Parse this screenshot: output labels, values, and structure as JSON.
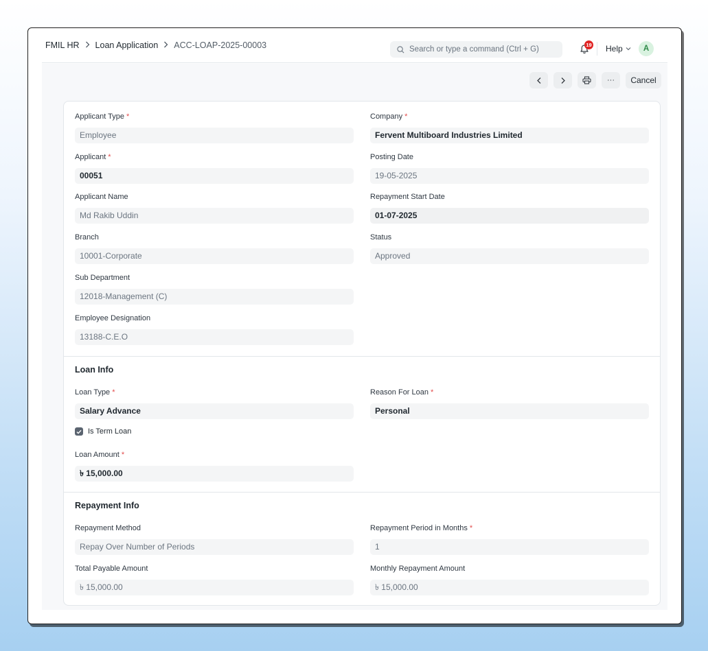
{
  "breadcrumb": {
    "root": "FMIL HR",
    "doctype": "Loan Application",
    "record": "ACC-LOAP-2025-00003"
  },
  "search": {
    "placeholder": "Search or type a command (Ctrl + G)"
  },
  "notifications": {
    "count": "19"
  },
  "help": {
    "label": "Help"
  },
  "user": {
    "initial": "A"
  },
  "toolbar": {
    "cancel_label": "Cancel",
    "more_label": "···"
  },
  "details": {
    "applicant_type": {
      "label": "Applicant Type",
      "value": "Employee",
      "required": true
    },
    "company": {
      "label": "Company",
      "value": "Fervent Multiboard Industries Limited",
      "required": true
    },
    "applicant": {
      "label": "Applicant",
      "value": "00051",
      "required": true
    },
    "posting_date": {
      "label": "Posting Date",
      "value": "19-05-2025"
    },
    "applicant_name": {
      "label": "Applicant Name",
      "value": "Md Rakib Uddin"
    },
    "repayment_start_date": {
      "label": "Repayment Start Date",
      "value": "01-07-2025"
    },
    "branch": {
      "label": "Branch",
      "value": "10001-Corporate"
    },
    "status": {
      "label": "Status",
      "value": "Approved"
    },
    "sub_department": {
      "label": "Sub Department",
      "value": "12018-Management (C)"
    },
    "employee_designation": {
      "label": "Employee Designation",
      "value": "13188-C.E.O"
    }
  },
  "loan_info": {
    "title": "Loan Info",
    "loan_type": {
      "label": "Loan Type",
      "value": "Salary Advance",
      "required": true
    },
    "reason_for_loan": {
      "label": "Reason For Loan",
      "value": "Personal",
      "required": true
    },
    "is_term_loan": {
      "label": "Is Term Loan",
      "checked": true
    },
    "loan_amount": {
      "label": "Loan Amount",
      "value": "৳ 15,000.00",
      "required": true
    }
  },
  "repayment_info": {
    "title": "Repayment Info",
    "repayment_method": {
      "label": "Repayment Method",
      "value": "Repay Over Number of Periods"
    },
    "repayment_period": {
      "label": "Repayment Period in Months",
      "value": "1",
      "required": true
    },
    "total_payable_amount": {
      "label": "Total Payable Amount",
      "value": "৳ 15,000.00"
    },
    "monthly_repayment_amount": {
      "label": "Monthly Repayment Amount",
      "value": "৳ 15,000.00"
    }
  },
  "colors": {
    "required_marker": "#e24c4c",
    "badge": "#e02424",
    "avatar_bg": "#d9f2e0",
    "avatar_fg": "#2f8a49"
  }
}
